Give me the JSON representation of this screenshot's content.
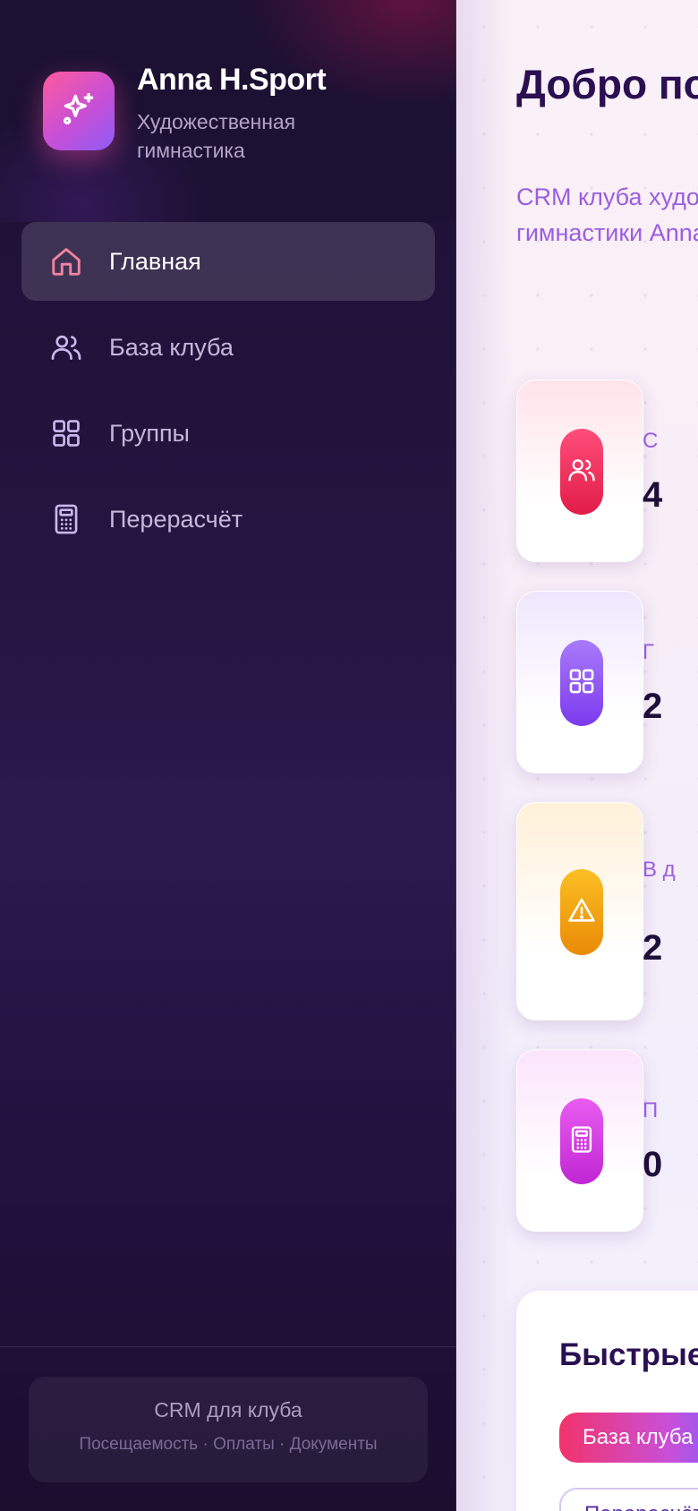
{
  "brand": {
    "title": "Anna H.Sport",
    "subtitle": "Художественная гимнастика",
    "logo_icon": "sparkles-icon"
  },
  "nav": {
    "items": [
      {
        "label": "Главная",
        "icon": "home-icon",
        "active": true
      },
      {
        "label": "База клуба",
        "icon": "users-icon",
        "active": false
      },
      {
        "label": "Группы",
        "icon": "grid-icon",
        "active": false
      },
      {
        "label": "Перерасчёт",
        "icon": "calculator-icon",
        "active": false
      }
    ]
  },
  "sidebar_footer": {
    "title": "CRM для клуба",
    "links": "Посещаемость · Оплаты · Документы"
  },
  "main": {
    "title": "Добро пожаловать",
    "subtitle": "CRM клуба художественной гимнастики Anna H.Sport",
    "stat_cards": [
      {
        "icon": "users-icon",
        "label_visible": "С",
        "value_visible": "4",
        "color": "#f43f5e"
      },
      {
        "icon": "grid-icon",
        "label_visible": "Г",
        "value_visible": "2",
        "color": "#8b5cf6"
      },
      {
        "icon": "warning-icon",
        "label_visible": "В д",
        "value_visible": "2",
        "color": "#f59e0b"
      },
      {
        "icon": "calculator-icon",
        "label_visible": "П",
        "value_visible": "0",
        "color": "#d946ef"
      }
    ],
    "quick_actions": {
      "title": "Быстрые действия",
      "primary_button": "База клуба",
      "secondary_button": "Перерасчёт"
    }
  },
  "colors": {
    "sidebar_bg": "#1f1238",
    "accent_pink": "#f2336b",
    "accent_purple": "#8d5cf6",
    "title_dark": "#2a0f52",
    "subtitle_purple": "#9a5ee0"
  }
}
